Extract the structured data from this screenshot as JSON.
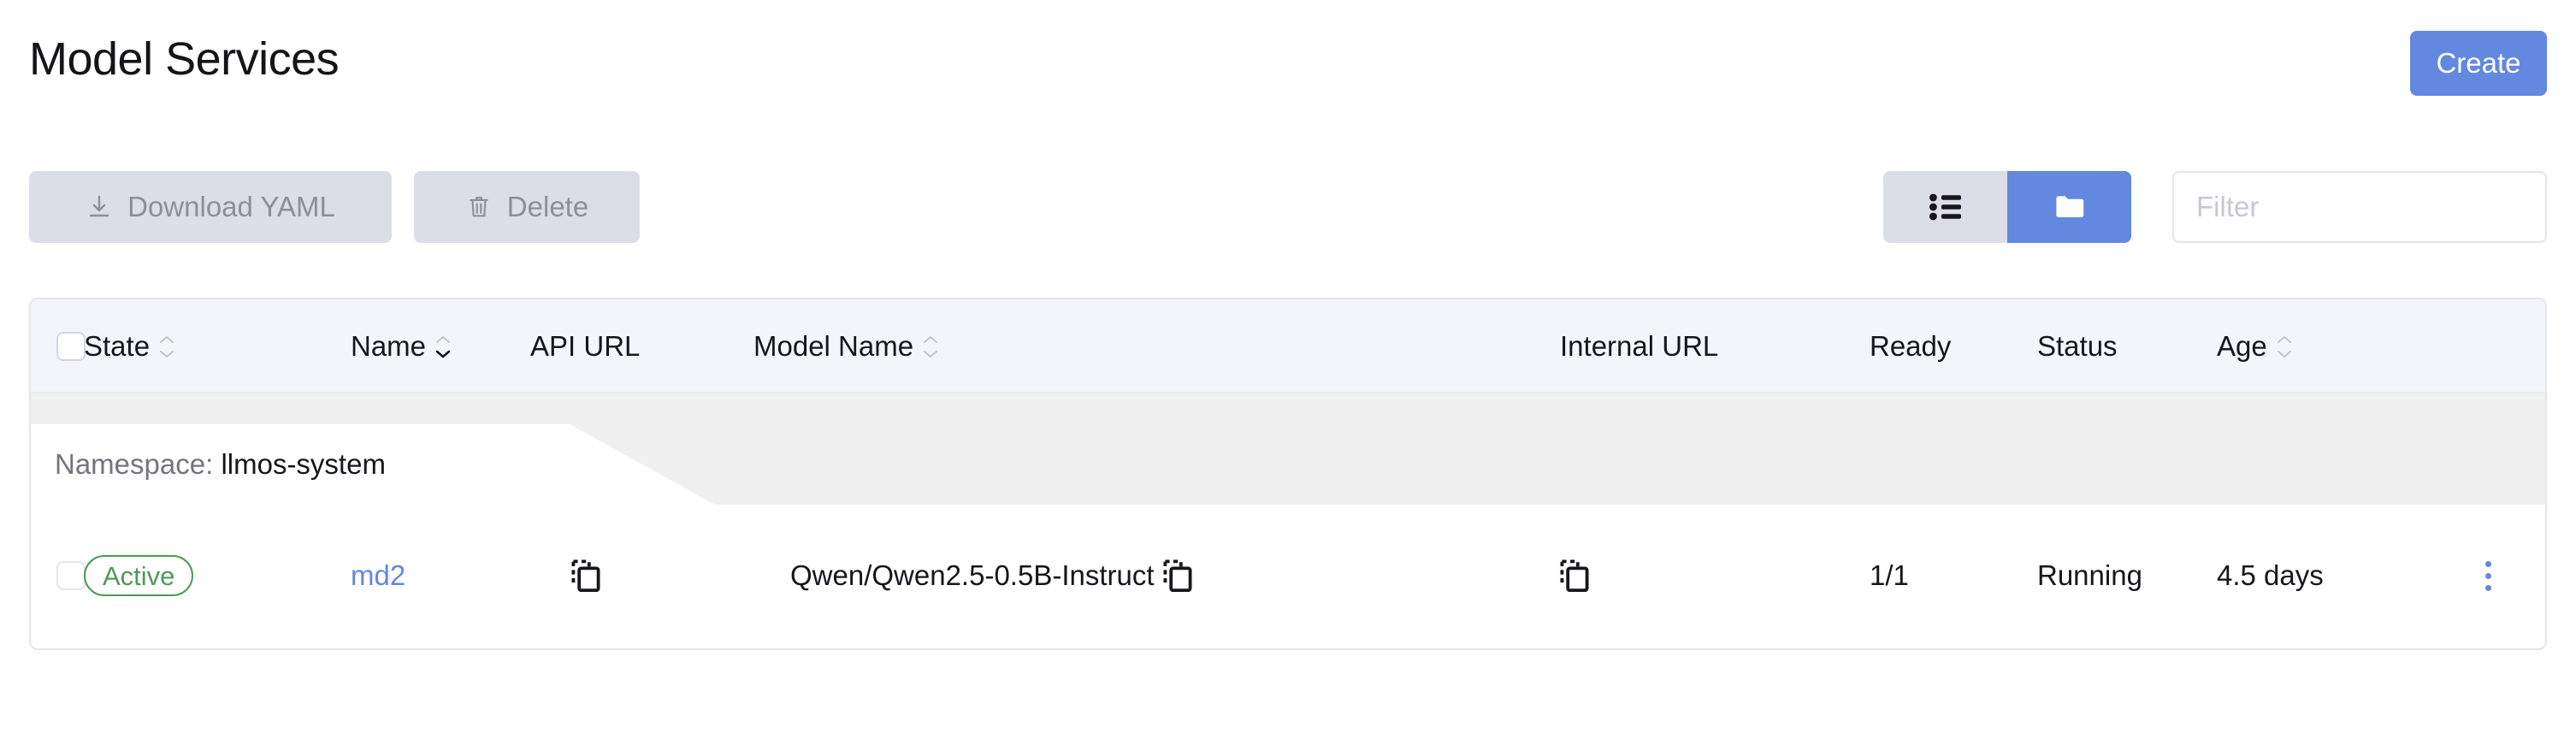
{
  "header": {
    "title": "Model Services",
    "create_label": "Create"
  },
  "toolbar": {
    "download_yaml_label": "Download YAML",
    "download_icon": "download-icon",
    "delete_label": "Delete",
    "delete_icon": "trash-icon",
    "view_toggle": {
      "list_icon": "list-view-icon",
      "group_icon": "folder-view-icon",
      "active": "group"
    },
    "filter": {
      "placeholder": "Filter",
      "value": ""
    }
  },
  "table": {
    "select_all_checkbox": "unchecked",
    "columns": [
      {
        "label": "State",
        "sortable": true,
        "sort": "none"
      },
      {
        "label": "Name",
        "sortable": true,
        "sort": "desc"
      },
      {
        "label": "API URL",
        "sortable": false,
        "sort": "none"
      },
      {
        "label": "Model Name",
        "sortable": true,
        "sort": "none"
      },
      {
        "label": "Internal URL",
        "sortable": false,
        "sort": "none"
      },
      {
        "label": "Ready",
        "sortable": false,
        "sort": "none"
      },
      {
        "label": "Status",
        "sortable": false,
        "sort": "none"
      },
      {
        "label": "Age",
        "sortable": true,
        "sort": "none"
      }
    ],
    "group": {
      "prefix": "Namespace:",
      "name": "llmos-system"
    },
    "rows": [
      {
        "checkbox": "unchecked",
        "state": "Active",
        "name": "md2",
        "api_url": "",
        "api_url_copy_icon": "copy-icon",
        "model_name": "Qwen/Qwen2.5-0.5B-Instruct",
        "model_name_copy_icon": "copy-icon",
        "internal_url": "",
        "internal_url_copy_icon": "copy-icon",
        "ready": "1/1",
        "status": "Running",
        "age": "4.5 days",
        "actions_icon": "kebab-menu-icon"
      }
    ]
  },
  "colors": {
    "accent": "#6288e0",
    "state_active": "#4d9a53",
    "muted_button": "#dcdee7",
    "header_bg": "#f4f5fa",
    "group_band": "#f0f0f1",
    "border": "#e3e5ee"
  }
}
